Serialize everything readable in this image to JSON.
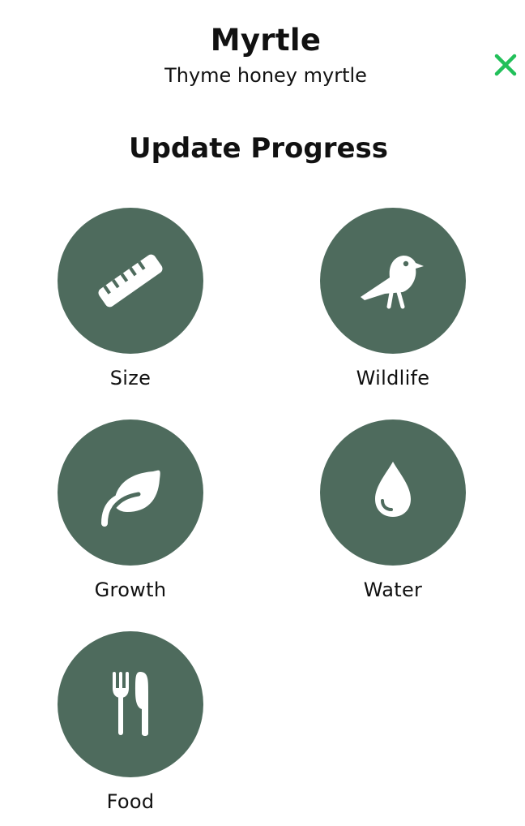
{
  "header": {
    "plant_name": "Myrtle",
    "plant_variety": "Thyme honey myrtle"
  },
  "section": {
    "title": "Update Progress"
  },
  "options": [
    {
      "label": "Size",
      "icon": "ruler-icon"
    },
    {
      "label": "Wildlife",
      "icon": "bird-icon"
    },
    {
      "label": "Growth",
      "icon": "leaf-icon"
    },
    {
      "label": "Water",
      "icon": "water-drop-icon"
    },
    {
      "label": "Food",
      "icon": "fork-knife-icon"
    }
  ],
  "colors": {
    "circle_background": "#4e6b5d",
    "icon_foreground": "#ffffff",
    "close_icon": "#22c05a",
    "text": "#111111"
  }
}
